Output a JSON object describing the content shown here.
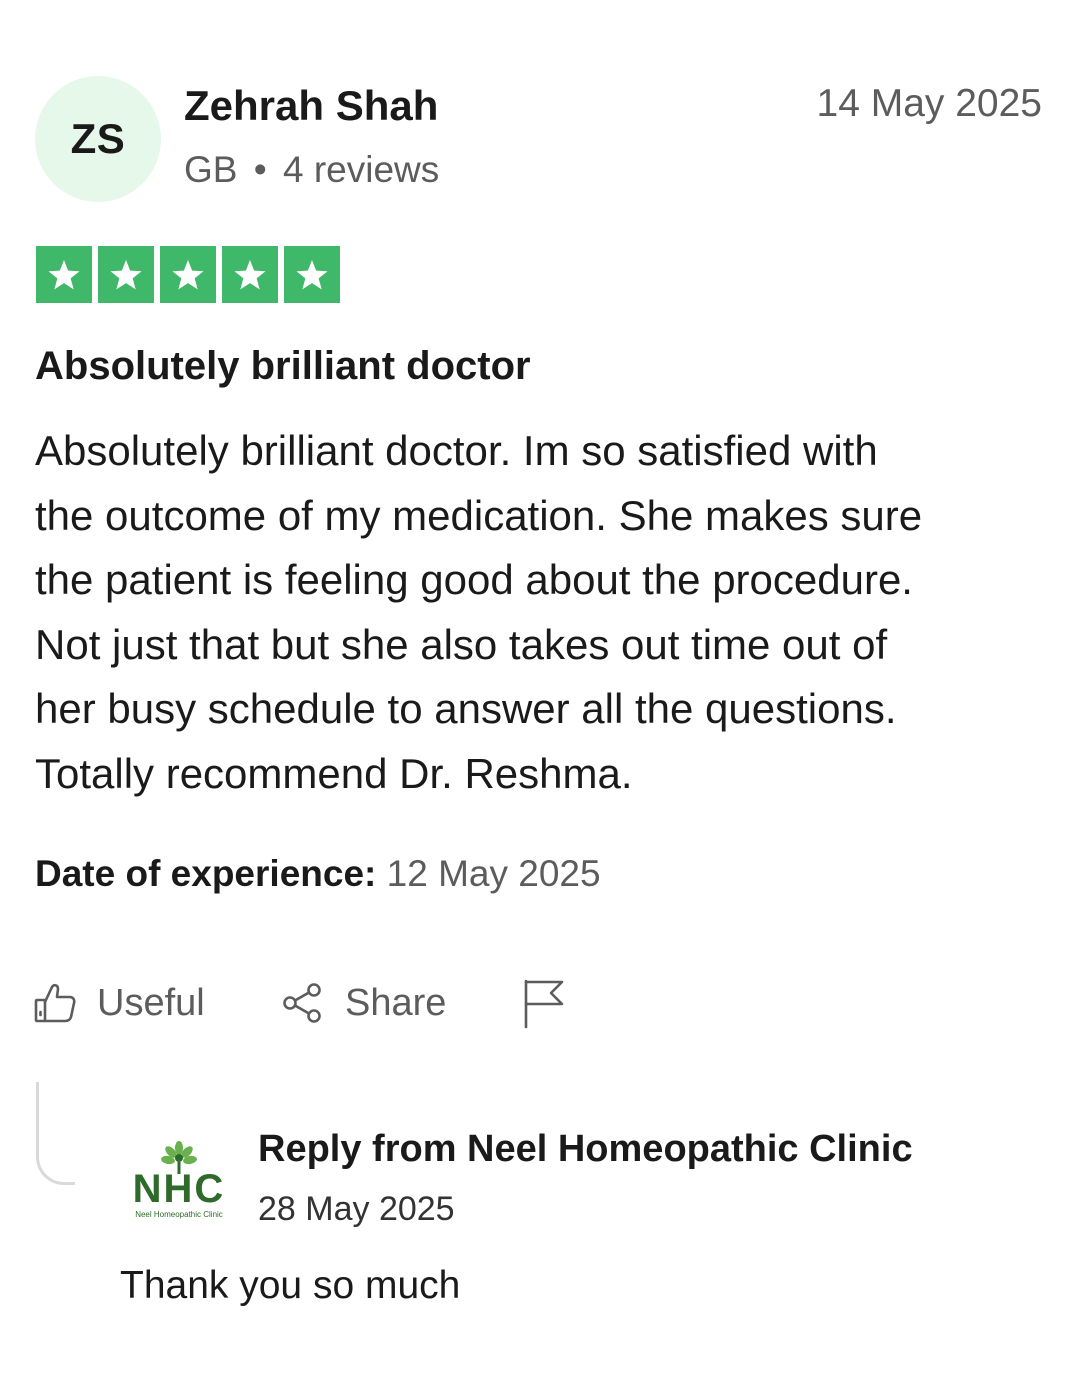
{
  "reviewer": {
    "initials": "ZS",
    "name": "Zehrah Shah",
    "country": "GB",
    "separator": "•",
    "reviews": "4 reviews"
  },
  "review": {
    "date": "14 May 2025",
    "rating": 5,
    "rating_max": 5,
    "title": "Absolutely brilliant doctor",
    "body_lines": [
      "Absolutely brilliant doctor. Im so satisfied with",
      "the outcome of my medication. She makes sure",
      "the patient is feeling good about the procedure.",
      "Not just that but she also takes out time out of",
      "her busy schedule to answer all the questions.",
      "Totally recommend Dr. Reshma."
    ],
    "experience_label": "Date of experience:",
    "experience_date": "12 May 2025"
  },
  "actions": {
    "useful_label": "Useful",
    "share_label": "Share",
    "useful_icon": "thumbs-up-icon",
    "share_icon": "share-icon",
    "flag_icon": "flag-icon"
  },
  "reply": {
    "logo_text": "NHC",
    "logo_subtext": "Neel Homeopathic Clinic",
    "title": "Reply from Neel Homeopathic Clinic",
    "date": "28 May 2025",
    "body": "Thank you so much"
  },
  "colors": {
    "star_green": "#3fb86a",
    "avatar_bg": "#e5f8ea",
    "logo_green": "#2e6b2a",
    "muted_text": "#5c5c5c"
  }
}
